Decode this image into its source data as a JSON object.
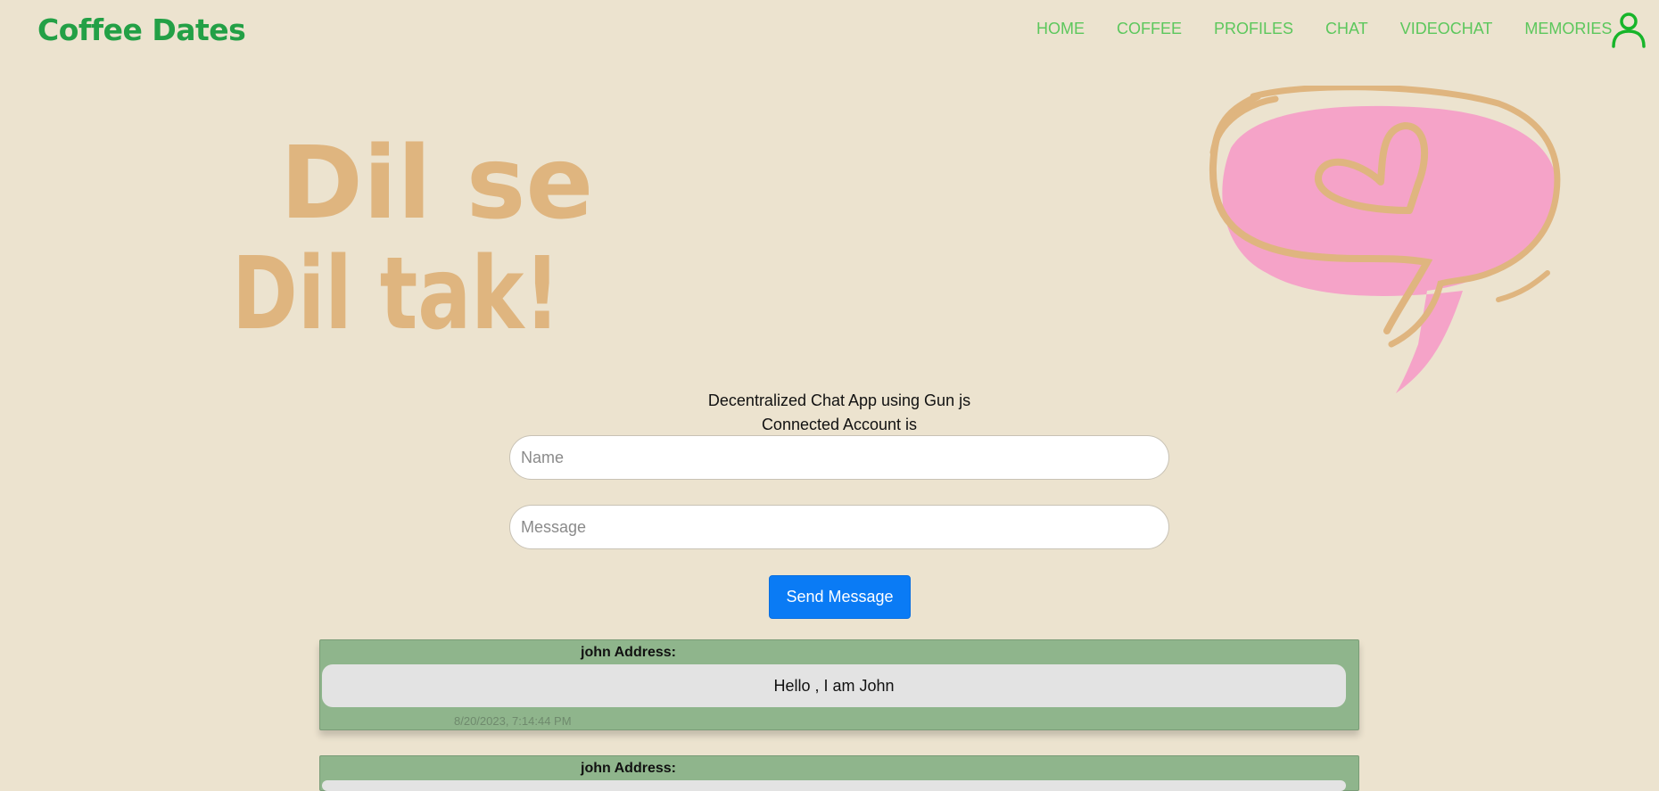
{
  "brand": "Coffee Dates",
  "nav": {
    "items": [
      "HOME",
      "COFFEE",
      "PROFILES",
      "CHAT",
      "VIDEOCHAT",
      "MEMORIES"
    ]
  },
  "hero": {
    "line1": "Dil se",
    "line2": "Dil tak!"
  },
  "icons": {
    "profile": "user-icon",
    "bubble": "heart-speech-bubble"
  },
  "colors": {
    "background": "#ece3cf",
    "brand": "#23a046",
    "nav": "#5cc75c",
    "hero_text": "#dfb57f",
    "bubble_fill": "#f5a3c8",
    "button": "#0a7bf5",
    "card": "#8fb58c",
    "card_body": "#e3e3e3"
  },
  "chat": {
    "title": "Decentralized Chat App using Gun js",
    "connected_label": "Connected Account is",
    "name_placeholder": "Name",
    "message_placeholder": "Message",
    "send_label": "Send Message"
  },
  "messages": [
    {
      "sender": "john Address:",
      "text": "Hello , I am John",
      "time": "8/20/2023, 7:14:44 PM"
    },
    {
      "sender": "john Address:"
    }
  ]
}
